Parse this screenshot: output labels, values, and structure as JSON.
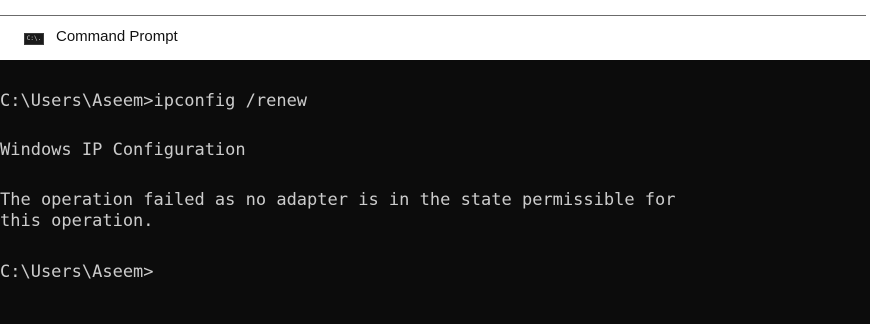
{
  "window": {
    "title": "Command Prompt",
    "icon": "command-prompt-icon",
    "icon_text": "C:\\."
  },
  "console": {
    "lines": [
      "C:\\Users\\Aseem>ipconfig /renew",
      "Windows IP Configuration",
      "The operation failed as no adapter is in the state permissible for",
      "this operation.",
      "C:\\Users\\Aseem>"
    ]
  },
  "colors": {
    "console_background": "#0c0c0c",
    "console_text": "#cccccc",
    "titlebar_background": "#ffffff"
  }
}
